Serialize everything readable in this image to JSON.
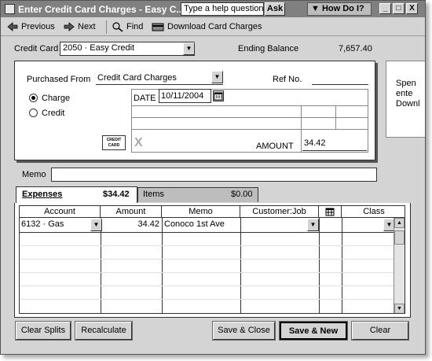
{
  "window": {
    "title": "Enter Credit Card Charges - Easy C...",
    "help_placeholder": "Type a help question",
    "ask_label": "Ask",
    "howdoi_label": "How Do I?",
    "controls": [
      "_",
      "□",
      "X"
    ]
  },
  "toolbar": {
    "previous_label": "Previous",
    "next_label": "Next",
    "find_label": "Find",
    "download_label": "Download Card Charges"
  },
  "header": {
    "credit_card_label": "Credit Card",
    "credit_card_value": "2050 · Easy Credit",
    "ending_balance_label": "Ending Balance",
    "ending_balance_value": "7,657.40"
  },
  "charge_form": {
    "purchased_from_label": "Purchased From",
    "purchased_from_value": "Credit Card Charges",
    "ref_no_label": "Ref No.",
    "ref_no_value": "",
    "charge_label": "Charge",
    "credit_label": "Credit",
    "selected_type": "Charge",
    "date_label": "DATE",
    "date_value": "10/11/2004",
    "amount_label": "AMOUNT",
    "amount_value": "34.42",
    "card_badge_line1": "CREDIT",
    "card_badge_line2": "CARD",
    "void_mark": "X"
  },
  "side_panel": {
    "lines": [
      "Spen",
      "ente",
      "Downl"
    ]
  },
  "memo": {
    "label": "Memo",
    "value": ""
  },
  "tabs": [
    {
      "label": "Expenses",
      "amount": "$34.42",
      "active": true
    },
    {
      "label": "Items",
      "amount": "$0.00",
      "active": false
    }
  ],
  "grid": {
    "columns": [
      "Account",
      "Amount",
      "Memo",
      "Customer:Job",
      "",
      "Class"
    ],
    "rows": [
      {
        "account": "6132 · Gas",
        "amount": "34.42",
        "memo": "Conoco 1st Ave",
        "customer_job": "",
        "billable": "",
        "class": ""
      }
    ]
  },
  "buttons": {
    "clear_splits": "Clear Splits",
    "recalculate": "Recalculate",
    "save_close": "Save & Close",
    "save_new": "Save & New",
    "clear": "Clear"
  }
}
